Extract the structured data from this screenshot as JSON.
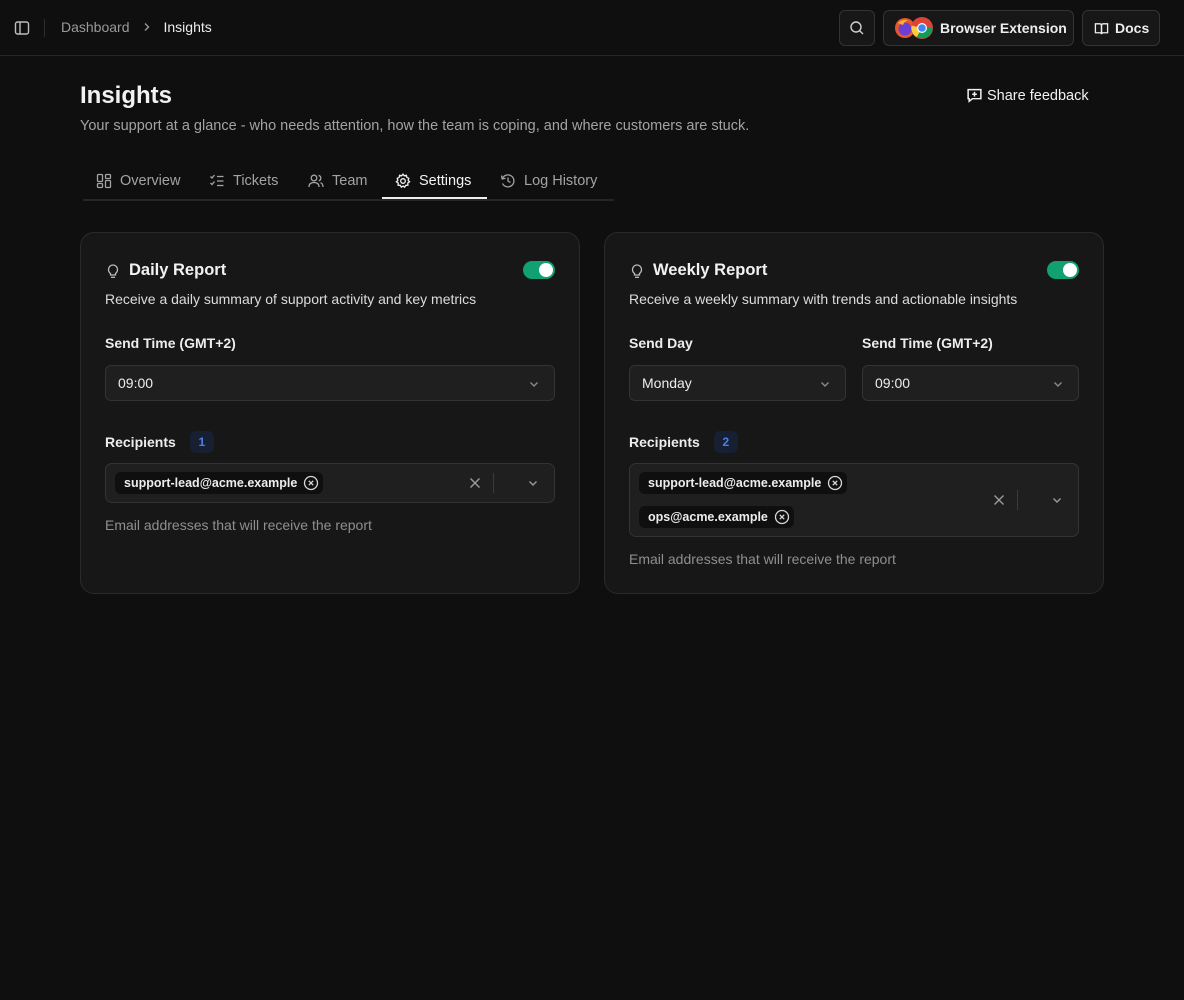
{
  "breadcrumb": {
    "parent": "Dashboard",
    "current": "Insights"
  },
  "topbar": {
    "extension_label": "Browser Extension",
    "docs_label": "Docs"
  },
  "header": {
    "title": "Insights",
    "subtitle": "Your support at a glance - who needs attention, how the team is coping, and where customers are stuck.",
    "feedback_label": "Share feedback"
  },
  "tabs": [
    {
      "label": "Overview",
      "icon": "layout-dashboard-icon"
    },
    {
      "label": "Tickets",
      "icon": "list-checks-icon"
    },
    {
      "label": "Team",
      "icon": "users-icon"
    },
    {
      "label": "Settings",
      "icon": "gear-icon",
      "active": true
    },
    {
      "label": "Log History",
      "icon": "history-icon"
    }
  ],
  "daily": {
    "title": "Daily Report",
    "enabled": true,
    "description": "Receive a daily summary of support activity and key metrics",
    "time_label": "Send Time (GMT+2)",
    "time_value": "09:00",
    "recipients_label": "Recipients",
    "recipients_count": "1",
    "recipients": [
      "support-lead@acme.example"
    ],
    "help": "Email addresses that will receive the report"
  },
  "weekly": {
    "title": "Weekly Report",
    "enabled": true,
    "description": "Receive a weekly summary with trends and actionable insights",
    "day_label": "Send Day",
    "day_value": "Monday",
    "time_label": "Send Time (GMT+2)",
    "time_value": "09:00",
    "recipients_label": "Recipients",
    "recipients_count": "2",
    "recipients": [
      "support-lead@acme.example",
      "ops@acme.example"
    ],
    "help": "Email addresses that will receive the report"
  },
  "colors": {
    "accent_toggle": "#10a071",
    "badge_text": "#4d7fe8",
    "background": "#0f0f0f",
    "card": "#171717"
  }
}
